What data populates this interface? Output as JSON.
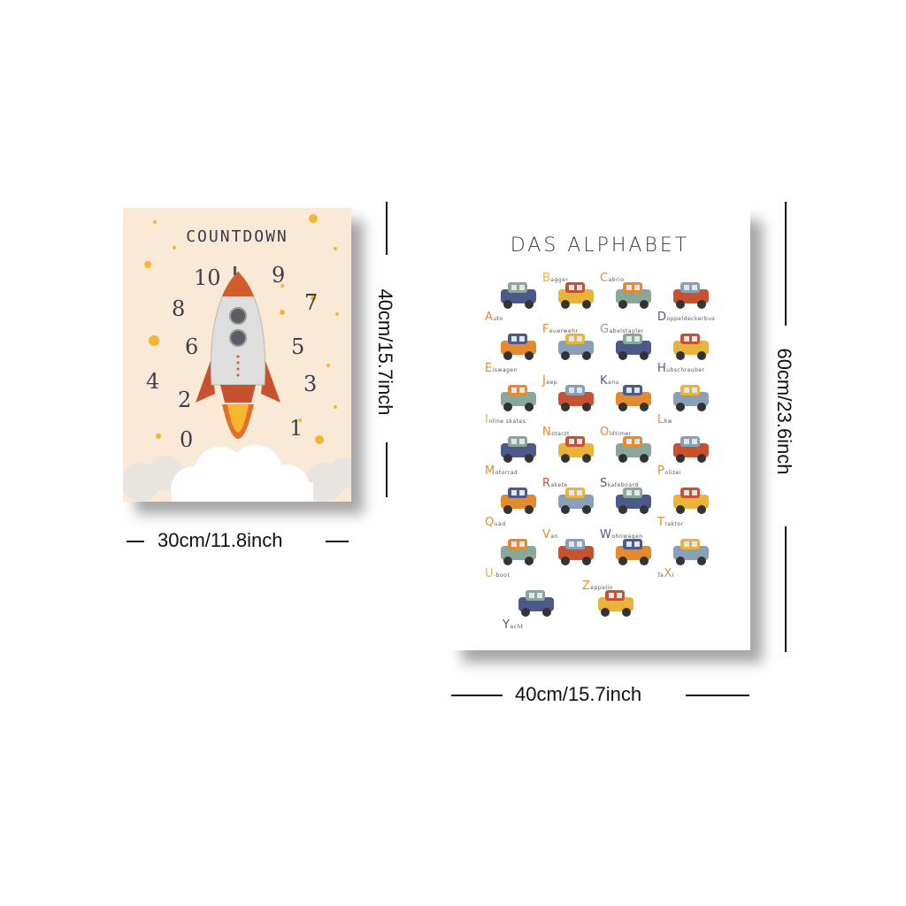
{
  "countdown": {
    "title": "COUNTDOWN",
    "numbers": [
      "10",
      "9",
      "8",
      "7",
      "6",
      "5",
      "4",
      "3",
      "2",
      "1",
      "0"
    ]
  },
  "alphabet": {
    "title": "DAS ALPHABET",
    "items": [
      {
        "letter": "A",
        "rest": "uto",
        "icon": "car-icon",
        "color": "#e38b2e"
      },
      {
        "letter": "B",
        "rest": "agger",
        "icon": "excavator-icon",
        "color": "#e9b43a"
      },
      {
        "letter": "C",
        "rest": "abrio",
        "icon": "convertible-icon",
        "color": "#e38b2e"
      },
      {
        "letter": "D",
        "rest": "oppeldeckerbus",
        "icon": "bus-icon",
        "color": "#4c5a8a"
      },
      {
        "letter": "E",
        "rest": "iswagen",
        "icon": "ice-cream-truck-icon",
        "color": "#e38b2e"
      },
      {
        "letter": "F",
        "rest": "euerwehr",
        "icon": "fire-truck-icon",
        "color": "#e38b2e"
      },
      {
        "letter": "G",
        "rest": "abelstapler",
        "icon": "forklift-icon",
        "color": "#8aa89a"
      },
      {
        "letter": "H",
        "rest": "ubschrauber",
        "icon": "helicopter-icon",
        "color": "#4c5a8a"
      },
      {
        "letter": "I",
        "rest": "nline skates",
        "icon": "inline-skate-icon",
        "color": "#e9b43a"
      },
      {
        "letter": "J",
        "rest": "eep",
        "icon": "jeep-icon",
        "color": "#e38b2e"
      },
      {
        "letter": "K",
        "rest": "anu",
        "icon": "canoe-icon",
        "color": "#4c5a8a"
      },
      {
        "letter": "L",
        "rest": "kw",
        "icon": "truck-icon",
        "color": "#e38b2e"
      },
      {
        "letter": "M",
        "rest": "otorrad",
        "icon": "scooter-icon",
        "color": "#e38b2e"
      },
      {
        "letter": "N",
        "rest": "otarzt",
        "icon": "ambulance-icon",
        "color": "#e38b2e"
      },
      {
        "letter": "O",
        "rest": "ldtimer",
        "icon": "vintage-car-icon",
        "color": "#e38b2e"
      },
      {
        "letter": "P",
        "rest": "olizei",
        "icon": "police-car-icon",
        "color": "#e38b2e"
      },
      {
        "letter": "Q",
        "rest": "uad",
        "icon": "quad-bike-icon",
        "color": "#e38b2e"
      },
      {
        "letter": "R",
        "rest": "akete",
        "icon": "rocket-icon",
        "color": "#c9522e"
      },
      {
        "letter": "S",
        "rest": "kateboard",
        "icon": "skateboard-icon",
        "color": "#4c5a8a"
      },
      {
        "letter": "T",
        "rest": "raktor",
        "icon": "tractor-icon",
        "color": "#e38b2e"
      },
      {
        "letter": "U",
        "rest": "-boot",
        "icon": "submarine-icon",
        "color": "#e9b43a"
      },
      {
        "letter": "V",
        "rest": "an",
        "icon": "van-icon",
        "color": "#e38b2e"
      },
      {
        "letter": "W",
        "rest": "ohnwagen",
        "icon": "caravan-icon",
        "color": "#4c5a8a"
      },
      {
        "letter": "X",
        "rest": "ta",
        "prefix": "Ta",
        "icon": "taxi-icon",
        "color": "#e38b2e"
      },
      {
        "letter": "Y",
        "rest": "acht",
        "icon": "yacht-icon",
        "color": "#4c5a8a"
      },
      {
        "letter": "Z",
        "rest": "eppelin",
        "icon": "zeppelin-icon",
        "color": "#e38b2e"
      }
    ]
  },
  "dimensions": {
    "countdown_width": "30cm/11.8inch",
    "countdown_height": "40cm/15.7inch",
    "alphabet_width": "40cm/15.7inch",
    "alphabet_height": "60cm/23.6inch"
  }
}
